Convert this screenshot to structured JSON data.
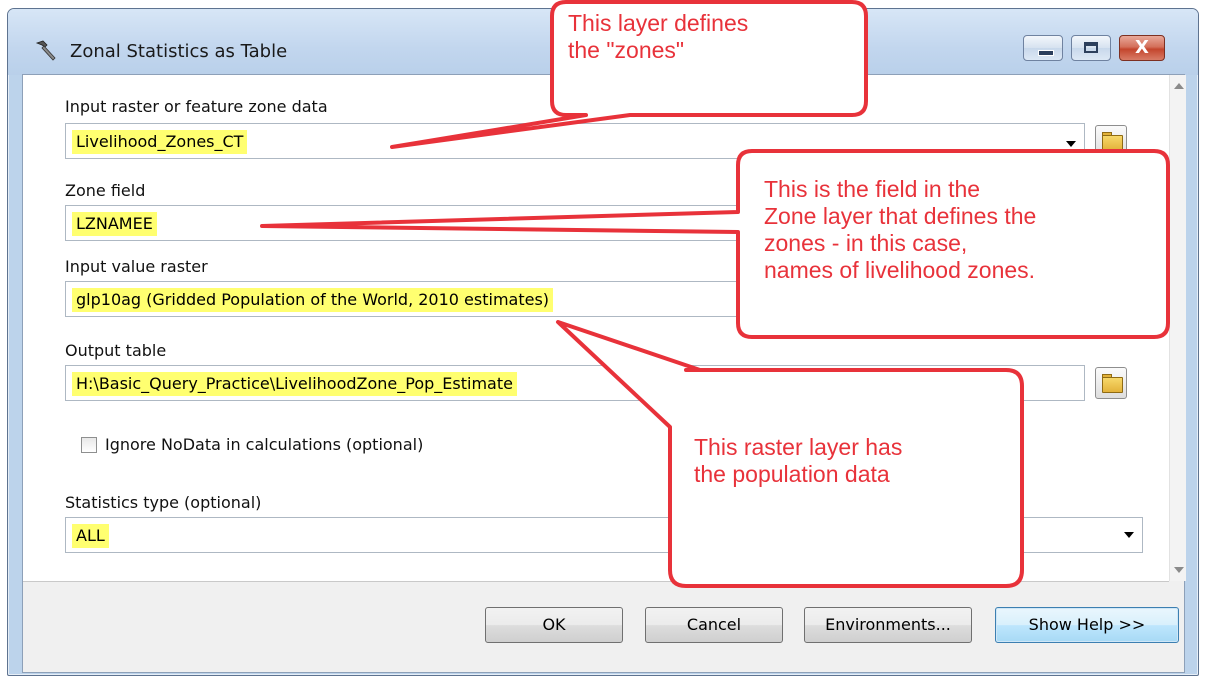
{
  "window": {
    "title": "Zonal Statistics as Table",
    "icon": "hammer-icon",
    "caption_buttons": [
      "minimize-icon",
      "maximize-icon",
      "close-icon"
    ],
    "close_glyph": "X"
  },
  "form": {
    "input_label": "Input raster or feature zone data",
    "input_value": "Livelihood_Zones_CT",
    "zone_label": "Zone field",
    "zone_value": "LZNAMEE",
    "value_raster_label": "Input value raster",
    "value_raster_value": "glp10ag (Gridded Population of the World, 2010 estimates)",
    "output_label": "Output table",
    "output_value": "H:\\Basic_Query_Practice\\LivelihoodZone_Pop_Estimate",
    "ignore_nodata_label": "Ignore NoData in calculations (optional)",
    "ignore_nodata_checked": false,
    "stats_label": "Statistics type (optional)",
    "stats_value": "ALL"
  },
  "buttons": {
    "ok": "OK",
    "cancel": "Cancel",
    "environments": "Environments...",
    "show_help": "Show Help >>"
  },
  "callouts": {
    "zones_line1": "This layer defines",
    "zones_line2": "the \"zones\"",
    "field_line1": "This is the field in the",
    "field_line2": "Zone layer that defines the",
    "field_line3": "zones - in this case,",
    "field_line4": "names of livelihood zones.",
    "raster_line1": "This raster layer has",
    "raster_line2": "the population data"
  },
  "colors": {
    "highlight": "#ffff70",
    "callout_border": "#e8323a",
    "callout_text": "#e8323a"
  }
}
